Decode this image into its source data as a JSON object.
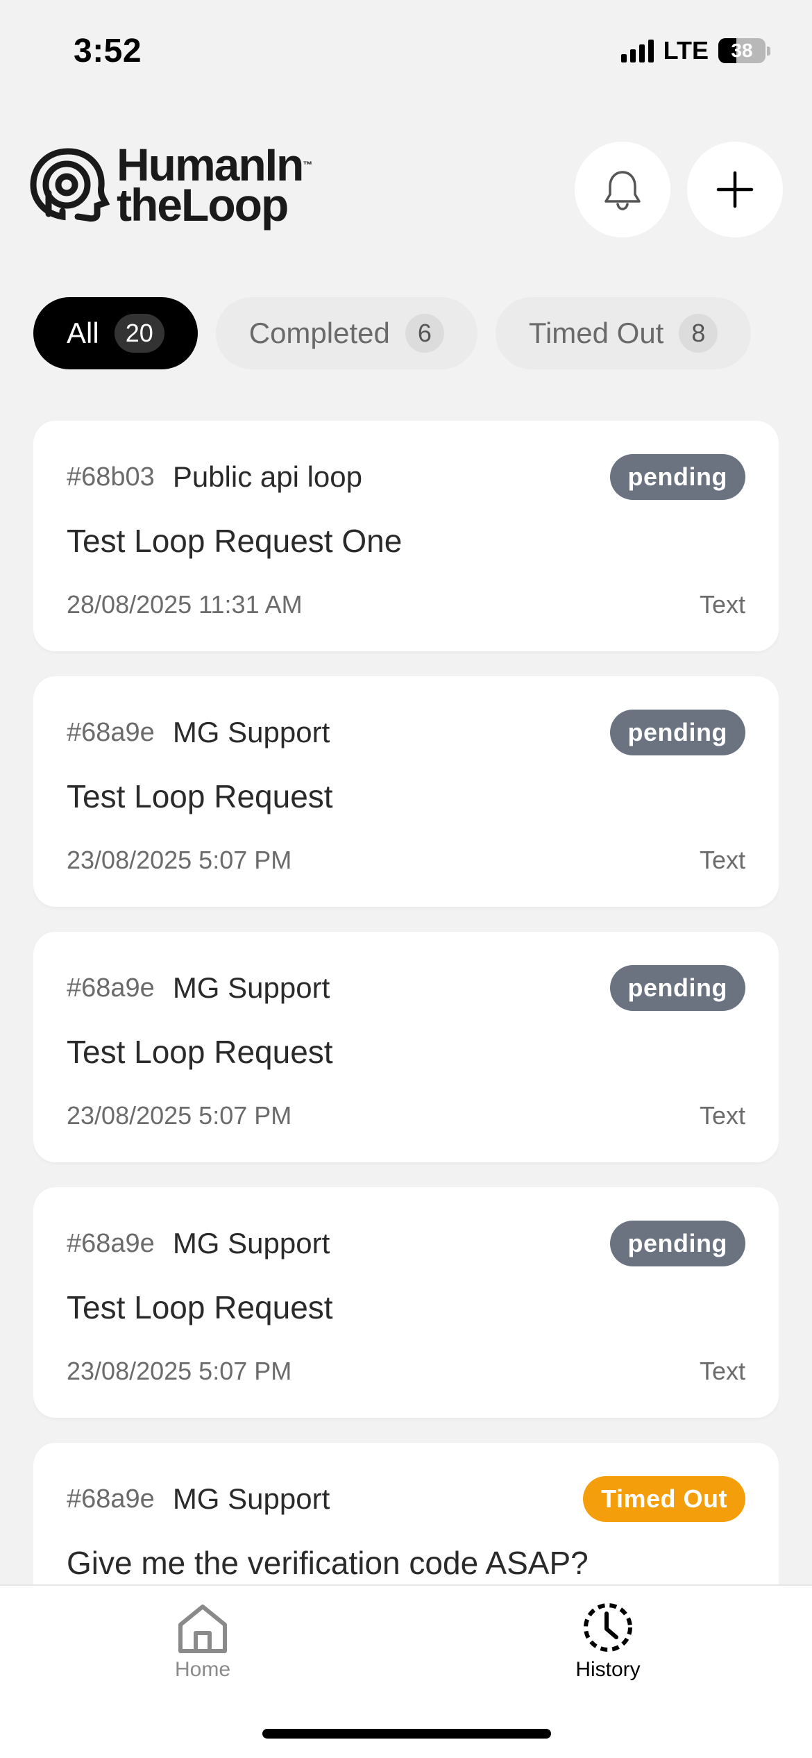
{
  "status_bar": {
    "time": "3:52",
    "network": "LTE",
    "battery": "38",
    "battery_level": 0.38
  },
  "header": {
    "logo_line1": "HumanIn",
    "logo_line2": "theLoop",
    "logo_tm": "™",
    "bell_icon": "bell-icon",
    "plus_icon": "plus-icon"
  },
  "tabs": [
    {
      "label": "All",
      "count": "20",
      "active": true
    },
    {
      "label": "Completed",
      "count": "6",
      "active": false
    },
    {
      "label": "Timed Out",
      "count": "8",
      "active": false
    }
  ],
  "requests": [
    {
      "id": "#68b03",
      "loop": "Public api loop",
      "status": "pending",
      "status_color": "#6b7280",
      "title": "Test Loop Request One",
      "timestamp": "28/08/2025 11:31 AM",
      "type": "Text"
    },
    {
      "id": "#68a9e",
      "loop": "MG Support",
      "status": "pending",
      "status_color": "#6b7280",
      "title": "Test Loop Request",
      "timestamp": "23/08/2025 5:07 PM",
      "type": "Text"
    },
    {
      "id": "#68a9e",
      "loop": "MG Support",
      "status": "pending",
      "status_color": "#6b7280",
      "title": "Test Loop Request",
      "timestamp": "23/08/2025 5:07 PM",
      "type": "Text"
    },
    {
      "id": "#68a9e",
      "loop": "MG Support",
      "status": "pending",
      "status_color": "#6b7280",
      "title": "Test Loop Request",
      "timestamp": "23/08/2025 5:07 PM",
      "type": "Text"
    },
    {
      "id": "#68a9e",
      "loop": "MG Support",
      "status": "Timed Out",
      "status_color": "#f59e0b",
      "title": "Give me the verification code ASAP?",
      "timestamp": "",
      "type": ""
    }
  ],
  "bottom_nav": {
    "home": {
      "label": "Home",
      "icon": "home-icon"
    },
    "history": {
      "label": "History",
      "icon": "history-icon"
    }
  }
}
